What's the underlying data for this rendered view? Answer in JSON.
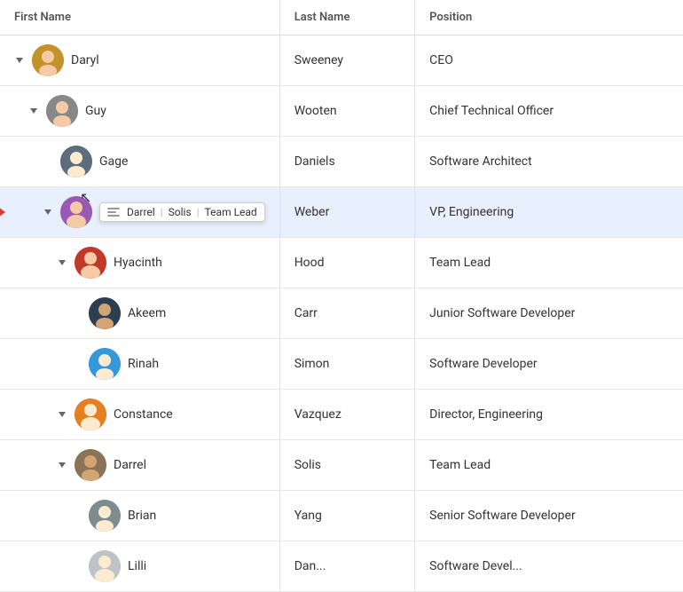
{
  "columns": {
    "firstname": "First Name",
    "lastname": "Last Name",
    "position": "Position"
  },
  "rows": [
    {
      "id": "daryl",
      "indent": 0,
      "toggle": "down",
      "firstName": "Daryl",
      "lastName": "Sweeney",
      "position": "CEO",
      "avatarClass": "avatar-daryl",
      "avatarInitial": "D",
      "highlighted": false,
      "showTagOverlay": false
    },
    {
      "id": "guy",
      "indent": 1,
      "toggle": "down",
      "firstName": "Guy",
      "lastName": "Wooten",
      "position": "Chief Technical Officer",
      "avatarClass": "avatar-guy",
      "avatarInitial": "G",
      "highlighted": false,
      "showTagOverlay": false
    },
    {
      "id": "gage",
      "indent": 2,
      "toggle": "none",
      "firstName": "Gage",
      "lastName": "Daniels",
      "position": "Software Architect",
      "avatarClass": "avatar-gage",
      "avatarInitial": "G",
      "highlighted": false,
      "showTagOverlay": false
    },
    {
      "id": "solis-vp",
      "indent": 2,
      "toggle": "down",
      "firstName": "",
      "lastName": "Weber",
      "position": "VP, Engineering",
      "avatarClass": "avatar-solis",
      "avatarInitial": "S",
      "highlighted": true,
      "showTagOverlay": true,
      "tagLabels": [
        "Darrel",
        "Solis",
        "Team Lead"
      ]
    },
    {
      "id": "hyacinth",
      "indent": 3,
      "toggle": "down",
      "firstName": "Hyacinth",
      "lastName": "Hood",
      "position": "Team Lead",
      "avatarClass": "avatar-hyacinth",
      "avatarInitial": "H",
      "highlighted": false,
      "showTagOverlay": false
    },
    {
      "id": "akeem",
      "indent": 4,
      "toggle": "none",
      "firstName": "Akeem",
      "lastName": "Carr",
      "position": "Junior Software Developer",
      "avatarClass": "avatar-akeem",
      "avatarInitial": "A",
      "highlighted": false,
      "showTagOverlay": false
    },
    {
      "id": "rinah",
      "indent": 4,
      "toggle": "none",
      "firstName": "Rinah",
      "lastName": "Simon",
      "position": "Software Developer",
      "avatarClass": "avatar-rinah",
      "avatarInitial": "R",
      "highlighted": false,
      "showTagOverlay": false
    },
    {
      "id": "constance",
      "indent": 3,
      "toggle": "down",
      "firstName": "Constance",
      "lastName": "Vazquez",
      "position": "Director, Engineering",
      "avatarClass": "avatar-constance",
      "avatarInitial": "C",
      "highlighted": false,
      "showTagOverlay": false
    },
    {
      "id": "darrel",
      "indent": 3,
      "toggle": "down",
      "firstName": "Darrel",
      "lastName": "Solis",
      "position": "Team Lead",
      "avatarClass": "avatar-darrel",
      "avatarInitial": "D",
      "highlighted": false,
      "showTagOverlay": false
    },
    {
      "id": "brian",
      "indent": 4,
      "toggle": "none",
      "firstName": "Brian",
      "lastName": "Yang",
      "position": "Senior Software Developer",
      "avatarClass": "avatar-brian",
      "avatarInitial": "B",
      "highlighted": false,
      "showTagOverlay": false
    },
    {
      "id": "lilli",
      "indent": 4,
      "toggle": "none",
      "firstName": "Lilli",
      "lastName": "Dan...",
      "position": "Software Devel...",
      "avatarClass": "avatar-lilli",
      "avatarInitial": "L",
      "highlighted": false,
      "showTagOverlay": false
    }
  ]
}
